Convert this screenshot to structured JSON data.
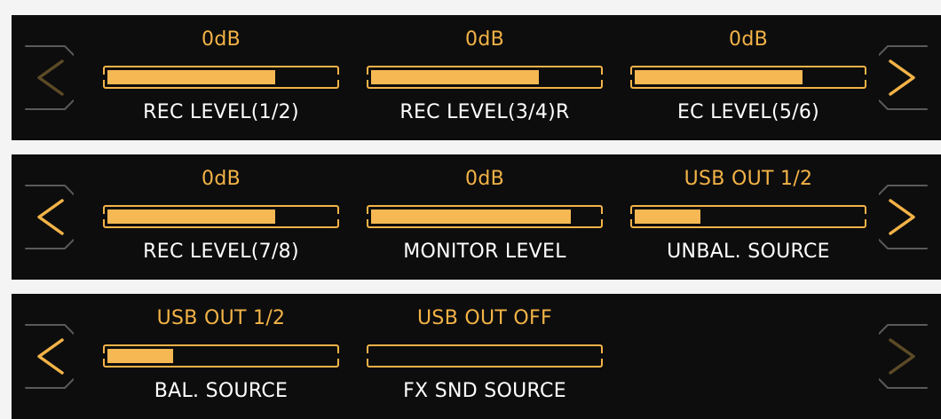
{
  "colors": {
    "accent": "#f3b347",
    "fill": "#f6b853",
    "panel_bg": "#0d0d0d",
    "page_bg": "#f4f4f4",
    "label": "#ffffff",
    "arrow_active": "#f3b347",
    "arrow_dim": "#5c4a26",
    "bracket": "#5a5a5a"
  },
  "pages": [
    {
      "nav_prev": {
        "icon": "chevron-left-icon",
        "state": "disabled"
      },
      "nav_next": {
        "icon": "chevron-right-icon",
        "state": "enabled"
      },
      "params": [
        {
          "value": "0dB",
          "label": "REC LEVEL(1/2)",
          "level": 0.74
        },
        {
          "value": "0dB",
          "label": "REC LEVEL(3/4)R",
          "level": 0.74
        },
        {
          "value": "0dB",
          "label": "EC LEVEL(5/6)",
          "level": 0.74
        }
      ]
    },
    {
      "nav_prev": {
        "icon": "chevron-left-icon",
        "state": "enabled"
      },
      "nav_next": {
        "icon": "chevron-right-icon",
        "state": "enabled"
      },
      "params": [
        {
          "value": "0dB",
          "label": "REC LEVEL(7/8)",
          "level": 0.74
        },
        {
          "value": "0dB",
          "label": "MONITOR LEVEL",
          "level": 0.88
        },
        {
          "value": "USB OUT 1/2",
          "label": "UNBAL. SOURCE",
          "level": 0.29
        }
      ]
    },
    {
      "nav_prev": {
        "icon": "chevron-left-icon",
        "state": "enabled"
      },
      "nav_next": {
        "icon": "chevron-right-icon",
        "state": "disabled"
      },
      "params": [
        {
          "value": "USB OUT 1/2",
          "label": "BAL. SOURCE",
          "level": 0.29
        },
        {
          "value": "USB OUT OFF",
          "label": "FX SND SOURCE",
          "level": 0
        }
      ]
    }
  ]
}
